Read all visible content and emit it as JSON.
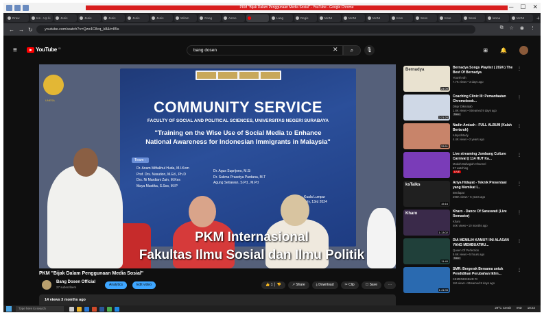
{
  "browser": {
    "title_bar_text": "PKM \"Bijak Dalam Penggunaan Media Sosial\" - YouTube - Google Chrome",
    "tabs": [
      "Draw",
      "Inn - Up ki",
      "Jenis",
      "Jenis",
      "Jenis",
      "Jenis",
      "Jenis",
      "Wilam",
      "Goog",
      "Asmo",
      "",
      "Lang",
      "Regis",
      "MANI",
      "MANI",
      "MANI",
      "Kom",
      "Sens",
      "Kore",
      "Sensi",
      "lanna",
      "MANI"
    ],
    "active_tab_index": 10,
    "url": "youtube.com/watch?v=Qzo4C8cq_k8&t=85s"
  },
  "youtube": {
    "logo_text": "YouTube",
    "country_code": "ID",
    "search_value": "bang dosen"
  },
  "video": {
    "banner": {
      "headline": "COMMUNITY SERVICE",
      "faculty": "FACULTY OF SOCIAL AND POLITICAL SCIENCES, UNIVERSITAS NEGERI SURABAYA",
      "training_line1": "\"Training on the Wise Use of Social Media to Enhance",
      "training_line2": "National Awareness for Indonesian Immigrants in Malaysia\"",
      "team_label": "Team :",
      "team_left": [
        "Dr. Anam Miftakhul Huda, M.I.Kom",
        "Prof. Drs. Nasution, M.Ed., Ph.D",
        "Drs. Ni Mardiani Zain, M.Kes",
        "Maya Mustika, S.Sos, M.IP"
      ],
      "team_right": [
        "Dr. Agus Suprijono, M.Si",
        "Dr. Sukma Prasetya Pardana, M.T",
        "Agung Setiawan, S.Pd., M.Pd"
      ],
      "venue_city": "Kuala Lumpur",
      "venue_date": "July, 13rd 2024",
      "emblem_text": "UNESA"
    },
    "caption_line1": "PKM Internasional",
    "caption_line2": "Fakultas Ilmu Sosial dan Ilmu Politik",
    "title": "PKM \"Bijak Dalam Penggunaan Media Sosial\"",
    "channel_name": "Bang Dosen Official",
    "subscribers": "27 subscribers",
    "analytics_label": "Analytics",
    "edit_label": "Edit video",
    "like_count": "1",
    "share_label": "Share",
    "download_label": "Download",
    "clip_label": "Clip",
    "save_label": "Save",
    "views_time": "14 views  3 months ago"
  },
  "recommendations": [
    {
      "title": "Bernadya Songs Playlist ( 2024 ) The Best Of Bernadya",
      "channel": "Yoursh sth",
      "meta": "7.7K views • 3 days ago",
      "duration": "24:09",
      "thumb_text": "Bernadya",
      "badge": "",
      "thumb_color": "#e9e2d0"
    },
    {
      "title": "Coaching Clinic III: Pemanfaatan Chromebook...",
      "channel": "Dikpr Dikmatab",
      "meta": "1.8K views • Streamed 9 days ago",
      "duration": "2:21:20",
      "thumb_text": "",
      "badge": "New",
      "thumb_color": "#cfd8e6"
    },
    {
      "title": "Nadin Amizah - FULL ALBUM (Kalah Bertaruh)",
      "channel": "rubyodstudy",
      "meta": "4.4K views • 2 years ago",
      "duration": "33:51",
      "thumb_text": "",
      "badge": "",
      "thumb_color": "#c8846a"
    },
    {
      "title": "Live streaming Jombang Culture Carnival || 114 HUT Ka...",
      "channel": "Mudah Bahagiah Channel",
      "meta": "57 watching",
      "duration": "",
      "thumb_text": "",
      "badge": "LIVE",
      "thumb_color": "#7a3cb8"
    },
    {
      "title": "Ariya Hidayat - Teknik Presentasi yang Memikat I...",
      "channel": "Berdapat",
      "meta": "296K views • 6 years ago",
      "duration": "15:16",
      "thumb_text": "ksTalks",
      "badge": "",
      "thumb_color": "#202020"
    },
    {
      "title": "Kharo - Dance Of Saraswati (Live Remaster)",
      "channel": "Kharo",
      "meta": "40K views • 10 months ago",
      "duration": "1:13:02",
      "thumb_text": "Kharo",
      "badge": "",
      "thumb_color": "#3a2a4a"
    },
    {
      "title": "DIA MEMILIH KAMU?! INI ALASAN YANG MEMBUATMU...",
      "channel": "Queen Of Perfection",
      "meta": "5.6K views • 5 hours ago",
      "duration": "11:40",
      "thumb_text": "",
      "badge": "New",
      "thumb_color": "#20403a"
    },
    {
      "title": "SMR: Bergerak Bersama untuk Pendidikan Perubahan Ikllm...",
      "channel": "KEMENDIKBUD RI",
      "meta": "1M views • Streamed 8 days ago",
      "duration": "1:41:05",
      "thumb_text": "",
      "badge": "",
      "thumb_color": "#2a6ab0"
    }
  ],
  "taskbar": {
    "search_placeholder": "Type here to search",
    "weather": "29°C Cerah",
    "lang": "IND",
    "time": "18:22"
  }
}
